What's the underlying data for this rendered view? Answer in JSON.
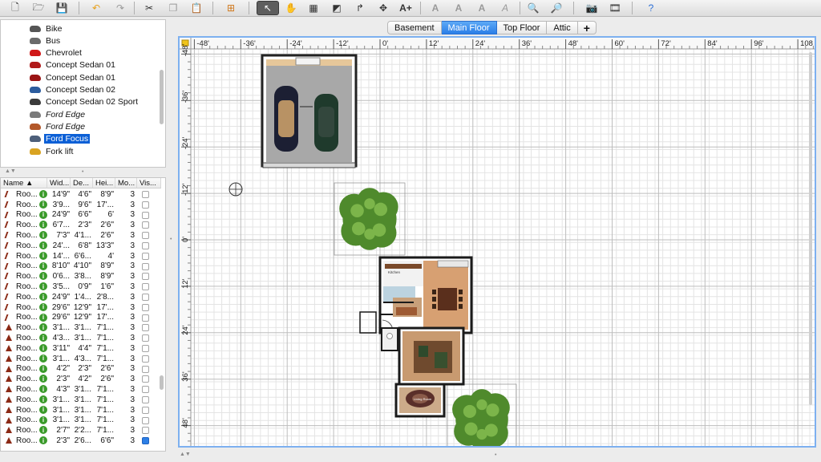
{
  "catalog": {
    "items": [
      {
        "label": "Bike",
        "icon": "bike-icon",
        "color": "#555555",
        "italic": false,
        "selected": false
      },
      {
        "label": "Bus",
        "icon": "bus-icon",
        "color": "#6a6a6a",
        "italic": false,
        "selected": false
      },
      {
        "label": "Chevrolet",
        "icon": "car-icon",
        "color": "#d01818",
        "italic": false,
        "selected": false
      },
      {
        "label": "Concept Sedan 01",
        "icon": "car-icon",
        "color": "#b01a1a",
        "italic": false,
        "selected": false
      },
      {
        "label": "Concept Sedan 01",
        "icon": "car-icon",
        "color": "#9a1414",
        "italic": false,
        "selected": false
      },
      {
        "label": "Concept Sedan 02",
        "icon": "car-icon",
        "color": "#2b5c9e",
        "italic": false,
        "selected": false
      },
      {
        "label": "Concept Sedan 02 Sport",
        "icon": "car-icon",
        "color": "#3b3b3b",
        "italic": false,
        "selected": false
      },
      {
        "label": "Ford Edge",
        "icon": "car-icon",
        "color": "#7a7a7a",
        "italic": true,
        "selected": false
      },
      {
        "label": "Ford Edge",
        "icon": "car-icon",
        "color": "#b3582a",
        "italic": true,
        "selected": false
      },
      {
        "label": "Ford Focus",
        "icon": "car-icon",
        "color": "#4d5f7a",
        "italic": false,
        "selected": true
      },
      {
        "label": "Fork lift",
        "icon": "forklift-icon",
        "color": "#d9a321",
        "italic": false,
        "selected": false
      }
    ]
  },
  "furniture_table": {
    "headers": [
      "Name ▲",
      "Wid...",
      "De...",
      "Hei...",
      "Mo...",
      "Vis..."
    ],
    "rows": [
      {
        "name": "Roo...",
        "icon": "slash",
        "w": "14'9\"",
        "d": "4'6\"",
        "h": "8'9\"",
        "m": "3",
        "v": false
      },
      {
        "name": "Roo...",
        "icon": "slash",
        "w": "3'9...",
        "d": "9'6\"",
        "h": "17'...",
        "m": "3",
        "v": false
      },
      {
        "name": "Roo...",
        "icon": "slash",
        "w": "24'9\"",
        "d": "6'6\"",
        "h": "6'",
        "m": "3",
        "v": false
      },
      {
        "name": "Roo...",
        "icon": "slash",
        "w": "6'7...",
        "d": "2'3\"",
        "h": "2'6\"",
        "m": "3",
        "v": false
      },
      {
        "name": "Roo...",
        "icon": "slash",
        "w": "7'3\"",
        "d": "4'1...",
        "h": "2'6\"",
        "m": "3",
        "v": false
      },
      {
        "name": "Roo...",
        "icon": "slash",
        "w": "24'...",
        "d": "6'8\"",
        "h": "13'3\"",
        "m": "3",
        "v": false
      },
      {
        "name": "Roo...",
        "icon": "slash",
        "w": "14'...",
        "d": "6'6...",
        "h": "4'",
        "m": "3",
        "v": false
      },
      {
        "name": "Roo...",
        "icon": "slash",
        "w": "8'10\"",
        "d": "4'10\"",
        "h": "8'9\"",
        "m": "3",
        "v": false
      },
      {
        "name": "Roo...",
        "icon": "slash",
        "w": "0'6...",
        "d": "3'8...",
        "h": "8'9\"",
        "m": "3",
        "v": false
      },
      {
        "name": "Roo...",
        "icon": "slash",
        "w": "3'5...",
        "d": "0'9\"",
        "h": "1'6\"",
        "m": "3",
        "v": false
      },
      {
        "name": "Roo...",
        "icon": "slash",
        "w": "24'9\"",
        "d": "1'4...",
        "h": "2'8...",
        "m": "3",
        "v": false
      },
      {
        "name": "Roo...",
        "icon": "slash",
        "w": "29'6\"",
        "d": "12'9\"",
        "h": "17'...",
        "m": "3",
        "v": false
      },
      {
        "name": "Roo...",
        "icon": "slash",
        "w": "29'6\"",
        "d": "12'9\"",
        "h": "17'...",
        "m": "3",
        "v": false
      },
      {
        "name": "Roo...",
        "icon": "tri",
        "w": "3'1...",
        "d": "3'1...",
        "h": "7'1...",
        "m": "3",
        "v": false
      },
      {
        "name": "Roo...",
        "icon": "tri",
        "w": "4'3...",
        "d": "3'1...",
        "h": "7'1...",
        "m": "3",
        "v": false
      },
      {
        "name": "Roo...",
        "icon": "tri",
        "w": "3'11\"",
        "d": "4'4\"",
        "h": "7'1...",
        "m": "3",
        "v": false
      },
      {
        "name": "Roo...",
        "icon": "tri",
        "w": "3'1...",
        "d": "4'3...",
        "h": "7'1...",
        "m": "3",
        "v": false
      },
      {
        "name": "Roo...",
        "icon": "tri",
        "w": "4'2\"",
        "d": "2'3\"",
        "h": "2'6\"",
        "m": "3",
        "v": false
      },
      {
        "name": "Roo...",
        "icon": "tri",
        "w": "2'3\"",
        "d": "4'2\"",
        "h": "2'6\"",
        "m": "3",
        "v": false
      },
      {
        "name": "Roo...",
        "icon": "tri",
        "w": "4'3\"",
        "d": "3'1...",
        "h": "7'1...",
        "m": "3",
        "v": false
      },
      {
        "name": "Roo...",
        "icon": "tri",
        "w": "3'1...",
        "d": "3'1...",
        "h": "7'1...",
        "m": "3",
        "v": false
      },
      {
        "name": "Roo...",
        "icon": "tri",
        "w": "3'1...",
        "d": "3'1...",
        "h": "7'1...",
        "m": "3",
        "v": false
      },
      {
        "name": "Roo...",
        "icon": "tri",
        "w": "3'1...",
        "d": "3'1...",
        "h": "7'1...",
        "m": "3",
        "v": false
      },
      {
        "name": "Roo...",
        "icon": "tri",
        "w": "2'7\"",
        "d": "2'2...",
        "h": "7'1...",
        "m": "3",
        "v": false
      },
      {
        "name": "Roo...",
        "icon": "tri",
        "w": "2'3\"",
        "d": "2'6...",
        "h": "6'6\"",
        "m": "3",
        "v": true
      }
    ]
  },
  "tabs": [
    {
      "label": "Basement",
      "active": false
    },
    {
      "label": "Main Floor",
      "active": true
    },
    {
      "label": "Top Floor",
      "active": false
    },
    {
      "label": "Attic",
      "active": false
    },
    {
      "label": "+",
      "active": false
    }
  ],
  "plan": {
    "ruler_x_labels": [
      "-48'",
      "-36'",
      "-24'",
      "-12'",
      "0'",
      "12'",
      "24'",
      "36'",
      "48'",
      "60'",
      "72'",
      "84'",
      "96'",
      "108"
    ],
    "ruler_y_labels": [
      "-48'",
      "-36'",
      "-24'",
      "-12'",
      "0'",
      "12'",
      "24'",
      "36'",
      "48'"
    ],
    "room_labels": [
      "Kitchen",
      "Living Room"
    ]
  },
  "toolbar": {
    "icons": [
      "new-file-icon",
      "open-folder-icon",
      "save-icon",
      "undo-icon",
      "redo-icon",
      "cut-icon",
      "copy-icon",
      "paste-icon",
      "add-furniture-icon",
      "select-arrow-icon",
      "pan-hand-icon",
      "create-walls-icon",
      "create-rooms-icon",
      "create-polylines-icon",
      "create-dimensions-icon",
      "add-text-icon",
      "text-style-1-icon",
      "text-style-2-icon",
      "bold-text-icon",
      "italic-text-icon",
      "zoom-in-icon",
      "zoom-out-icon",
      "camera-photo-icon",
      "video-icon",
      "help-icon"
    ]
  }
}
